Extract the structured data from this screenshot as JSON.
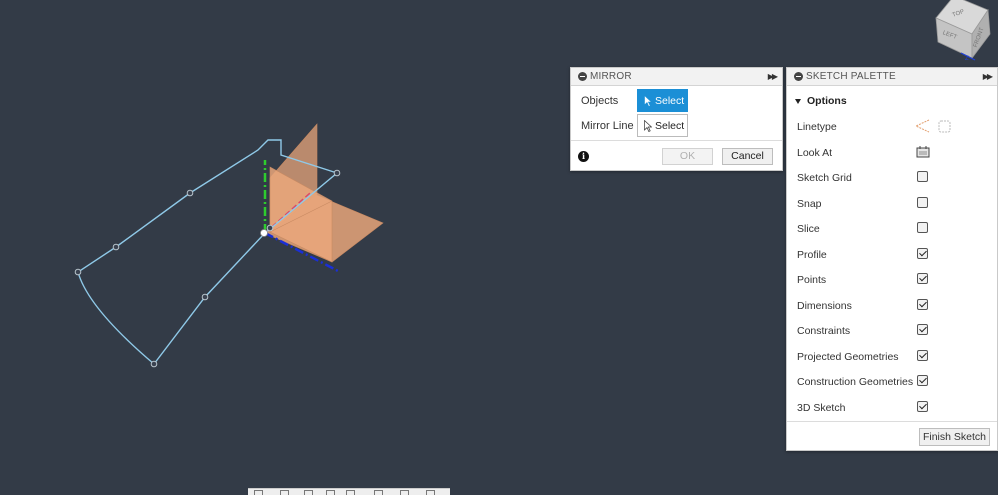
{
  "mirror_dialog": {
    "title": "MIRROR",
    "objects_label": "Objects",
    "objects_button": "Select",
    "mirror_line_label": "Mirror Line",
    "mirror_line_button": "Select",
    "ok_label": "OK",
    "cancel_label": "Cancel"
  },
  "sketch_palette": {
    "title": "SKETCH PALETTE",
    "section": "Options",
    "linetype_label": "Linetype",
    "look_at_label": "Look At",
    "options": [
      {
        "label": "Sketch Grid",
        "checked": false
      },
      {
        "label": "Snap",
        "checked": false
      },
      {
        "label": "Slice",
        "checked": false
      },
      {
        "label": "Profile",
        "checked": true
      },
      {
        "label": "Points",
        "checked": true
      },
      {
        "label": "Dimensions",
        "checked": true
      },
      {
        "label": "Constraints",
        "checked": true
      },
      {
        "label": "Projected Geometries",
        "checked": true
      },
      {
        "label": "Construction Geometries",
        "checked": true
      },
      {
        "label": "3D Sketch",
        "checked": true
      }
    ],
    "finish_label": "Finish Sketch"
  },
  "view_cube": {
    "labels": [
      "TOP",
      "LEFT",
      "FRONT"
    ]
  },
  "colors": {
    "canvas_bg": "#333b47",
    "sketch_line": "#8fc9e8",
    "axis_green": "#2ecc2e",
    "axis_blue": "#1a2fd6",
    "plane_fill": "#e8a67a",
    "accent": "#1b8fd6"
  },
  "icons": [
    "cursor-icon",
    "info-icon",
    "linetype-icon",
    "look-at-icon",
    "view-cube-icon"
  ]
}
